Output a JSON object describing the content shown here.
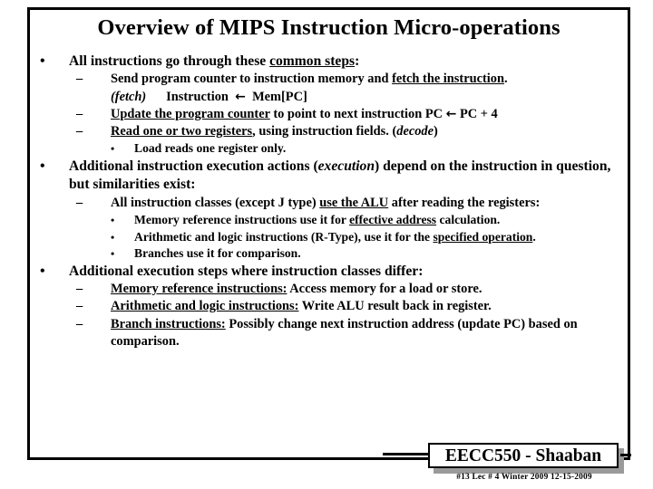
{
  "slide": {
    "title": "Overview of MIPS Instruction Micro-operations",
    "background_color": "#ffffff",
    "text_color": "#000000",
    "border_color": "#000000"
  },
  "bullets": {
    "b1": "All instructions go through these ",
    "b1_u": "common steps",
    "b1_end": ":",
    "b2a_pre": "Send program counter to instruction memory and ",
    "b2a_u": "fetch the instruction",
    "b2a_end": ".",
    "b2a_line2_i": "(fetch)",
    "b2a_line2_mid": "Instruction",
    "b2a_line2_arrow": "←",
    "b2a_line2_end": "Mem[PC]",
    "b2b_u": "Update the program counter",
    "b2b_mid": " to point to next instruction   PC ",
    "b2b_arrow": "←",
    "b2b_end": " PC + 4",
    "b2c_u": "Read one or two registers",
    "b2c_mid": ", using instruction fields. (",
    "b2c_i": "decode",
    "b2c_end": ")",
    "b3a": "Load reads one register only.",
    "b4_pre": "Additional instruction execution actions (",
    "b4_i": "execution",
    "b4_post": ") depend on the instruction in question, but similarities exist:",
    "b5_pre": "All instruction classes  (except J type) ",
    "b5_u": "use the ALU",
    "b5_post": " after reading the registers:",
    "b6a_pre": "Memory reference instructions use it for ",
    "b6a_u": "effective address",
    "b6a_post": " calculation.",
    "b6b_pre": "Arithmetic and logic instructions (R-Type), use it for the ",
    "b6b_u": "specified operation",
    "b6b_post": ".",
    "b6c": "Branches use it for comparison.",
    "b7": "Additional execution steps where instruction classes differ:",
    "b8a_u": "Memory reference instructions:",
    "b8a_post": "  Access memory for a load or store.",
    "b8b_u": "Arithmetic and logic instructions:",
    "b8b_post": "  Write ALU result back in register.",
    "b8c_u": "Branch instructions:",
    "b8c_post": "  Possibly change next instruction address (update PC) based on comparison."
  },
  "markers": {
    "level1": "•",
    "level2": "–",
    "level3": "•"
  },
  "footer": {
    "badge_label": "EECC550 - Shaaban",
    "meta": "#13   Lec # 4   Winter 2009   12-15-2009",
    "shadow_color": "#9a9a9a"
  }
}
